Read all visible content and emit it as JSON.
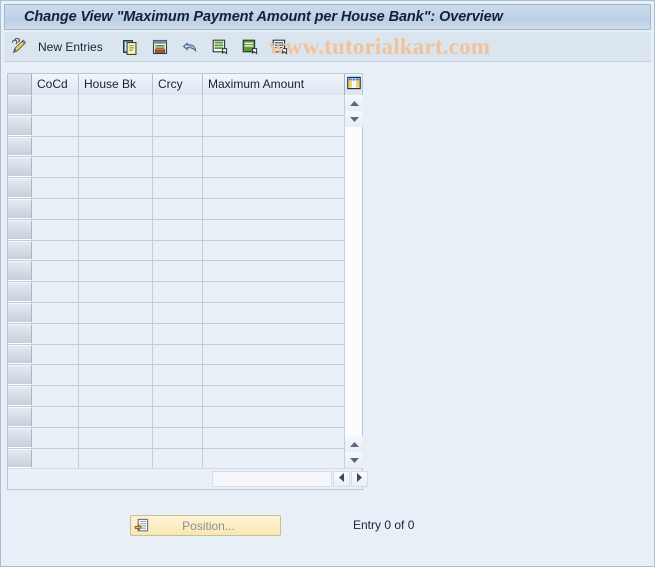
{
  "window": {
    "title": "Change View \"Maximum Payment Amount per House Bank\": Overview"
  },
  "toolbar": {
    "edit_icon": "pencil-icon",
    "new_entries_label": "New Entries",
    "buttons": [
      {
        "name": "copy-as-button",
        "icon": "copy-icon"
      },
      {
        "name": "delete-button",
        "icon": "delete-row-icon"
      },
      {
        "name": "undo-button",
        "icon": "undo-arrow-icon"
      },
      {
        "name": "select-all-button",
        "icon": "select-all-icon"
      },
      {
        "name": "select-block-button",
        "icon": "select-block-icon"
      },
      {
        "name": "deselect-all-button",
        "icon": "deselect-all-icon"
      }
    ]
  },
  "watermark": {
    "text": "www.tutorialkart.com",
    "color": "#f0c39a"
  },
  "table": {
    "columns": [
      {
        "key": "select",
        "label": ""
      },
      {
        "key": "cocd",
        "label": "CoCd"
      },
      {
        "key": "housebk",
        "label": "House Bk"
      },
      {
        "key": "crcy",
        "label": "Crcy"
      },
      {
        "key": "amount",
        "label": "Maximum Amount"
      }
    ],
    "rows": [],
    "empty_row_count": 18,
    "column_config_icon": "table-settings-icon",
    "vertical_scrollbar": {
      "up_icon": "triangle-up-icon",
      "down_icon": "triangle-down-icon"
    },
    "horizontal_scrollbar": {
      "left_icon": "triangle-left-icon",
      "right_icon": "triangle-right-icon"
    }
  },
  "footer": {
    "position_button_label": "Position...",
    "position_button_icon": "position-icon",
    "entry_count_text": "Entry 0 of 0"
  },
  "colors": {
    "page_background": "#e9eff7",
    "title_bar": "#c2d4e9",
    "table_background": "#eaf0f8",
    "grid_line": "#c2cedc",
    "button_yellow": "#fbeec6"
  }
}
